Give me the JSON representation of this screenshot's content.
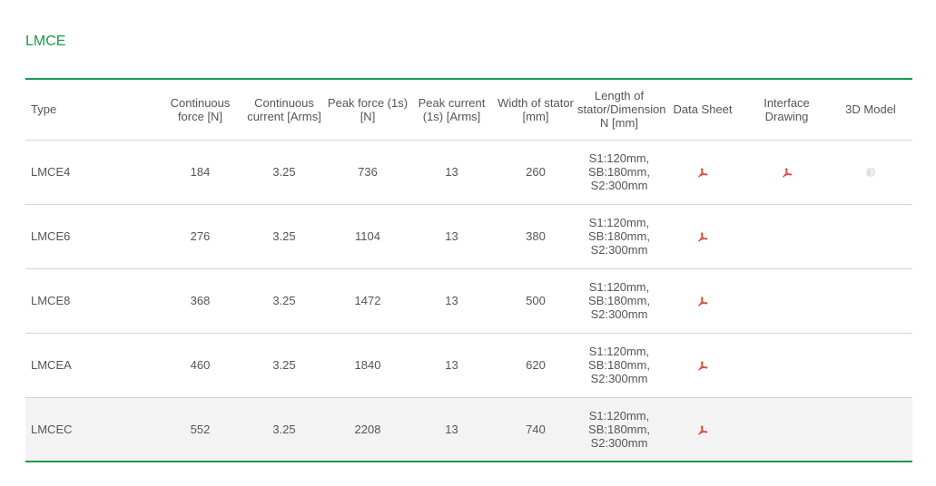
{
  "section": {
    "title": "LMCE"
  },
  "colors": {
    "accent": "#1a9a4a",
    "pdf_icon": "#e0453a",
    "row_shade": "#f3f3f3"
  },
  "table": {
    "headers": {
      "type": "Type",
      "continuous_force": "Continuous force [N]",
      "continuous_current": "Continuous current [Arms]",
      "peak_force": "Peak force (1s) [N]",
      "peak_current": "Peak current (1s) [Arms]",
      "width_of_stator": "Width of stator [mm]",
      "length_of_stator": "Length of stator/Dimension N [mm]",
      "data_sheet": "Data Sheet",
      "interface_drawing": "Interface Drawing",
      "model_3d": "3D Model"
    },
    "rows": [
      {
        "type": "LMCE4",
        "continuous_force": "184",
        "continuous_current": "3.25",
        "peak_force": "736",
        "peak_current": "13",
        "width_of_stator": "260",
        "length_line1": "S1:120mm,",
        "length_line2": "SB:180mm,",
        "length_line3": "S2:300mm",
        "data_sheet_icon": "pdf-icon",
        "interface_drawing_icon": "pdf-icon",
        "model_3d_icon": "3d-model-icon"
      },
      {
        "type": "LMCE6",
        "continuous_force": "276",
        "continuous_current": "3.25",
        "peak_force": "1104",
        "peak_current": "13",
        "width_of_stator": "380",
        "length_line1": "S1:120mm,",
        "length_line2": "SB:180mm,",
        "length_line3": "S2:300mm",
        "data_sheet_icon": "pdf-icon"
      },
      {
        "type": "LMCE8",
        "continuous_force": "368",
        "continuous_current": "3.25",
        "peak_force": "1472",
        "peak_current": "13",
        "width_of_stator": "500",
        "length_line1": "S1:120mm,",
        "length_line2": "SB:180mm,",
        "length_line3": "S2:300mm",
        "data_sheet_icon": "pdf-icon"
      },
      {
        "type": "LMCEA",
        "continuous_force": "460",
        "continuous_current": "3.25",
        "peak_force": "1840",
        "peak_current": "13",
        "width_of_stator": "620",
        "length_line1": "S1:120mm,",
        "length_line2": "SB:180mm,",
        "length_line3": "S2:300mm",
        "data_sheet_icon": "pdf-icon"
      },
      {
        "type": "LMCEC",
        "continuous_force": "552",
        "continuous_current": "3.25",
        "peak_force": "2208",
        "peak_current": "13",
        "width_of_stator": "740",
        "length_line1": "S1:120mm,",
        "length_line2": "SB:180mm,",
        "length_line3": "S2:300mm",
        "data_sheet_icon": "pdf-icon"
      }
    ]
  }
}
